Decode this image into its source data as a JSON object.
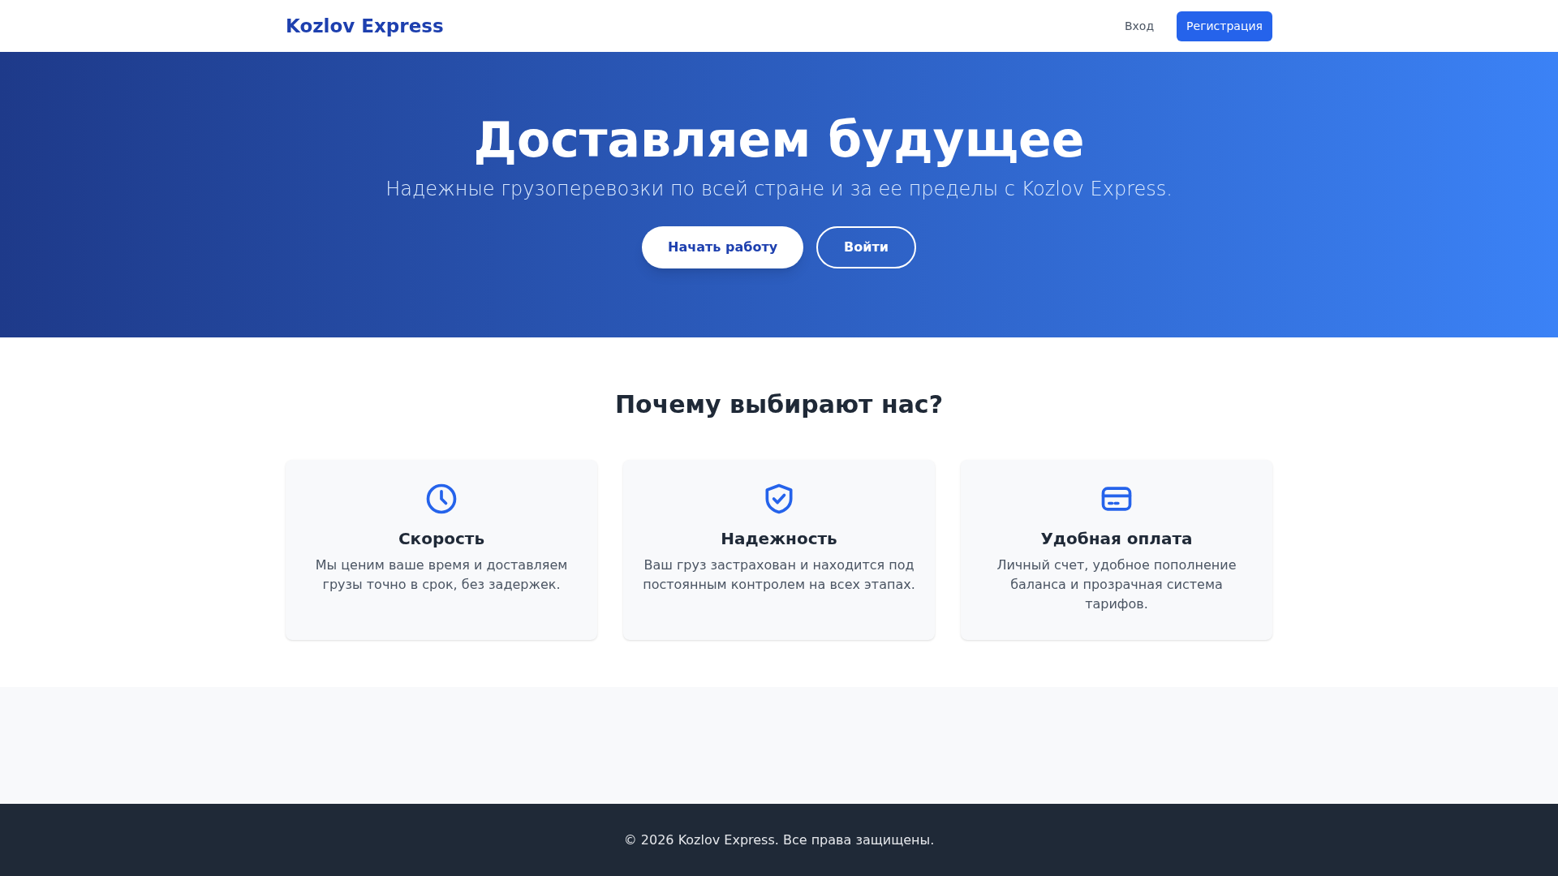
{
  "header": {
    "logo": "Kozlov Express",
    "links": [
      {
        "label": "Вход",
        "kind": "link"
      },
      {
        "label": "Регистрация",
        "kind": "primary"
      }
    ]
  },
  "hero": {
    "title": "Доставляем будущее",
    "subtitle": "Надежные грузоперевозки по всей стране и за ее пределы с Kozlov Express.",
    "buttons": [
      {
        "label": "Начать работу",
        "kind": "solid"
      },
      {
        "label": "Войти",
        "kind": "outline"
      }
    ]
  },
  "features": {
    "title": "Почему выбирают нас?",
    "cards": [
      {
        "kind": "clock",
        "title": "Скорость",
        "text": "Мы ценим ваше время и доставляем грузы точно в срок, без задержек."
      },
      {
        "kind": "shield",
        "title": "Надежность",
        "text": "Ваш груз застрахован и находится под постоянным контролем на всех этапах."
      },
      {
        "kind": "card",
        "title": "Удобная оплата",
        "text": "Личный счет, удобное пополнение баланса и прозрачная система тарифов."
      }
    ]
  },
  "footer": {
    "text": "© 2026 Kozlov Express. Все права защищены."
  }
}
